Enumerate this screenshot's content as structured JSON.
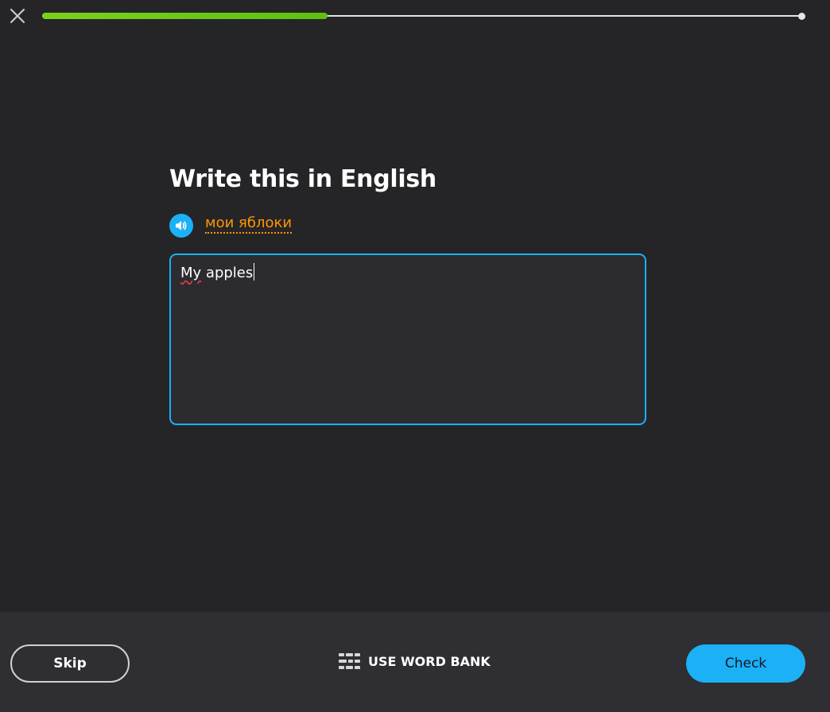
{
  "header": {
    "close_icon": "close-icon",
    "progress": 0.375
  },
  "challenge": {
    "title": "Write this in English",
    "speaker_icon": "speaker-icon",
    "prompt": "мои яблоки",
    "answer_misspelled": "My",
    "answer_rest": " apples"
  },
  "footer": {
    "skip_label": "Skip",
    "word_bank_icon": "word-bank-icon",
    "word_bank_label": "USE WORD BANK",
    "check_label": "Check"
  },
  "colors": {
    "background": "#252528",
    "footer_background": "#2e2e33",
    "progress_fill": "#79d11d",
    "accent_blue": "#1cb0f6",
    "prompt_orange": "#ff9600"
  }
}
